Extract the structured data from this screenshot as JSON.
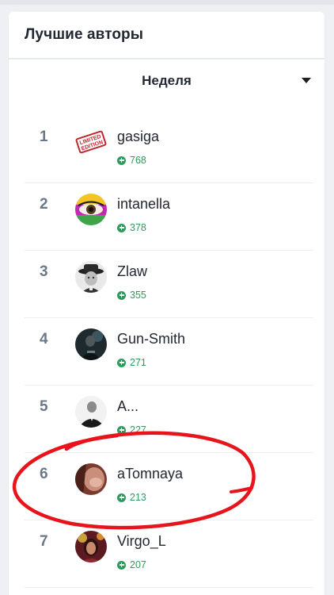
{
  "widget": {
    "title": "Лучшие авторы",
    "period": "Неделя"
  },
  "authors": [
    {
      "rank": "1",
      "name": "gasiga",
      "score": "768",
      "avatar_icon": "limited-edition-stamp-avatar"
    },
    {
      "rank": "2",
      "name": "intanella",
      "score": "378",
      "avatar_icon": "colorful-eye-avatar"
    },
    {
      "rank": "3",
      "name": "Zlaw",
      "score": "355",
      "avatar_icon": "man-in-hat-avatar"
    },
    {
      "rank": "4",
      "name": "Gun-Smith",
      "score": "271",
      "avatar_icon": "dark-figure-avatar"
    },
    {
      "rank": "5",
      "name": "A...",
      "score": "227",
      "avatar_icon": "man-in-suit-avatar"
    },
    {
      "rank": "6",
      "name": "aTomnaya",
      "score": "213",
      "avatar_icon": "blurred-face-avatar"
    },
    {
      "rank": "7",
      "name": "Virgo_L",
      "score": "207",
      "avatar_icon": "woman-portrait-avatar"
    }
  ],
  "colors": {
    "score_green": "#2f9a5c",
    "rank_gray": "#6c7787",
    "annotation_red": "#e8141c"
  }
}
